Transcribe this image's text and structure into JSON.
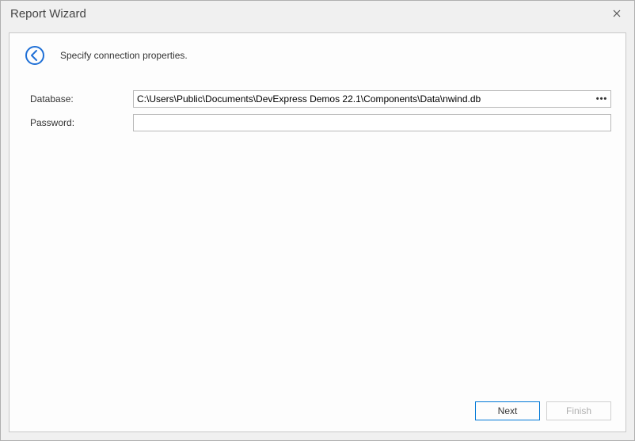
{
  "titlebar": {
    "title": "Report Wizard"
  },
  "header": {
    "instruction": "Specify connection properties."
  },
  "form": {
    "database_label": "Database:",
    "database_value": "C:\\Users\\Public\\Documents\\DevExpress Demos 22.1\\Components\\Data\\nwind.db",
    "password_label": "Password:",
    "password_value": ""
  },
  "buttons": {
    "next": "Next",
    "finish": "Finish"
  }
}
